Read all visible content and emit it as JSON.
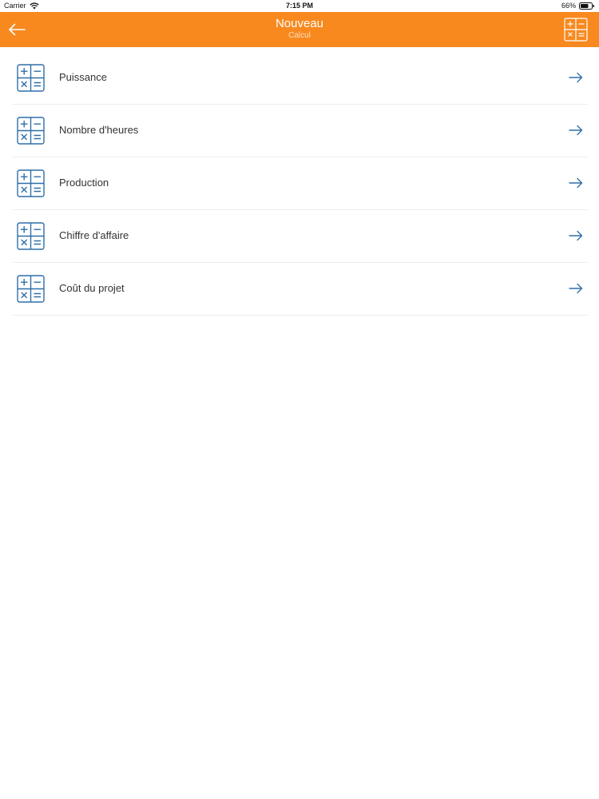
{
  "status_bar": {
    "carrier": "Carrier",
    "time": "7:15 PM",
    "battery": "66%"
  },
  "nav": {
    "title": "Nouveau",
    "subtitle": "Calcul",
    "back_icon": "arrow-left-icon",
    "action_icon": "calculator-icon"
  },
  "colors": {
    "accent": "#f7891f",
    "icon_blue": "#2f6fa8"
  },
  "items": [
    {
      "label": "Puissance"
    },
    {
      "label": "Nombre d'heures"
    },
    {
      "label": "Production"
    },
    {
      "label": "Chiffre d'affaire"
    },
    {
      "label": "Coût du projet"
    }
  ]
}
